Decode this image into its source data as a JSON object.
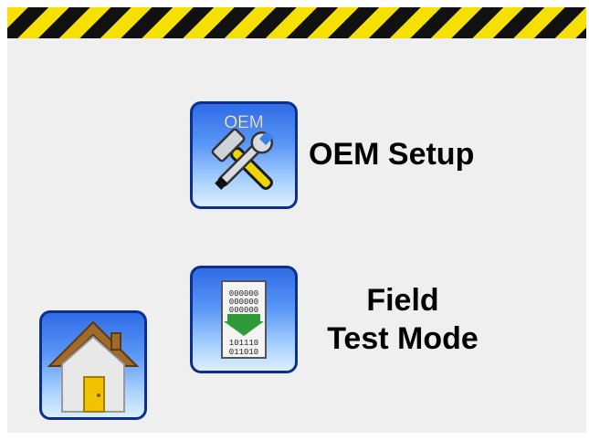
{
  "colors": {
    "hazard_yellow": "#f5e000",
    "hazard_black": "#111111",
    "tile_border": "#0b2f8f",
    "tile_blue": "#2f6ce6",
    "background": "#efefef"
  },
  "oem_setup": {
    "icon_text": "OEM",
    "label": "OEM Setup",
    "icon": "wrench-hammer-icon"
  },
  "field_test_mode": {
    "label_line1": "Field",
    "label_line2": "Test Mode",
    "icon": "binary-data-transfer-icon",
    "icon_digits_top": "000000",
    "icon_digits_bottom1": "101110",
    "icon_digits_bottom2": "011010"
  },
  "home": {
    "icon": "home-icon"
  }
}
